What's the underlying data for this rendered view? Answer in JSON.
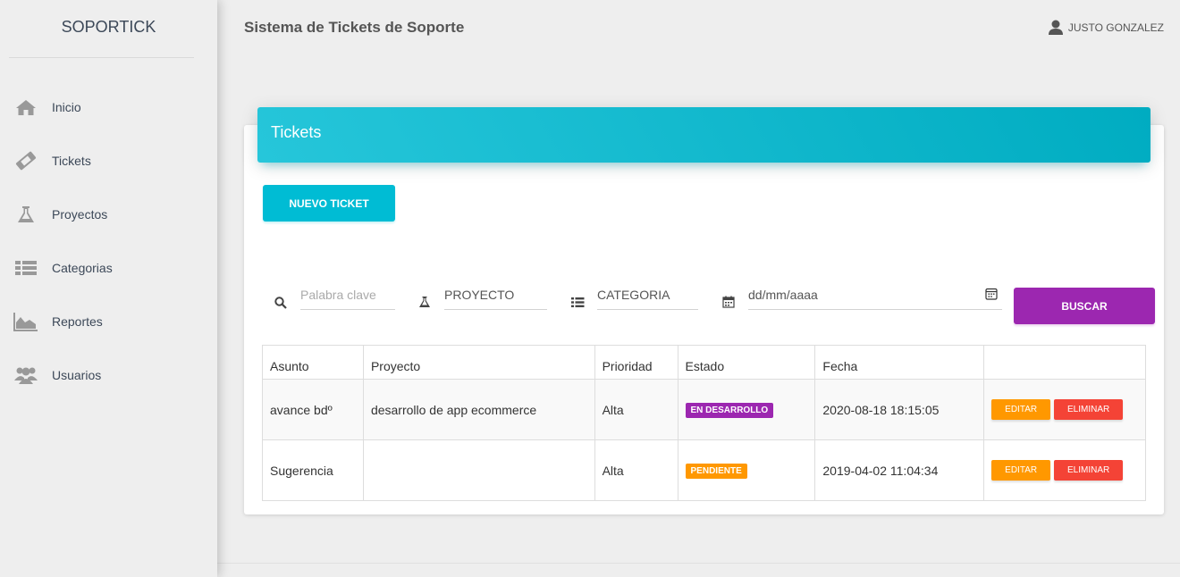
{
  "brand": "SOPORTICK",
  "header": {
    "title": "Sistema de Tickets de Soporte",
    "user": "JUSTO GONZALEZ"
  },
  "sidebar": {
    "items": [
      {
        "label": "Inicio",
        "icon": "home-icon"
      },
      {
        "label": "Tickets",
        "icon": "ticket-icon"
      },
      {
        "label": "Proyectos",
        "icon": "flask-icon"
      },
      {
        "label": "Categorias",
        "icon": "list-icon"
      },
      {
        "label": "Reportes",
        "icon": "area-chart-icon"
      },
      {
        "label": "Usuarios",
        "icon": "users-icon"
      }
    ]
  },
  "card": {
    "title": "Tickets",
    "new_button": "NUEVO TICKET"
  },
  "filters": {
    "keyword_placeholder": "Palabra clave",
    "project": "PROYECTO",
    "category": "CATEGORIA",
    "date": "dd/mm/aaaa",
    "search_button": "BUSCAR"
  },
  "table": {
    "headers": [
      "Asunto",
      "Proyecto",
      "Prioridad",
      "Estado",
      "Fecha",
      ""
    ],
    "rows": [
      {
        "asunto": "avance bdº",
        "proyecto": "desarrollo de app ecommerce",
        "prioridad": "Alta",
        "estado": "EN DESARROLLO",
        "fecha": "2020-08-18 18:15:05"
      },
      {
        "asunto": "Sugerencia",
        "proyecto": "",
        "prioridad": "Alta",
        "estado": "PENDIENTE",
        "fecha": "2019-04-02 11:04:34"
      }
    ],
    "edit_label": "EDITAR",
    "delete_label": "ELIMINAR"
  },
  "colors": {
    "accent": "#00bcd4",
    "search": "#9c27b0",
    "status_en_desarrollo": "#9c27b0",
    "status_pendiente": "#ff9800",
    "edit": "#ff9800",
    "delete": "#f44336"
  }
}
